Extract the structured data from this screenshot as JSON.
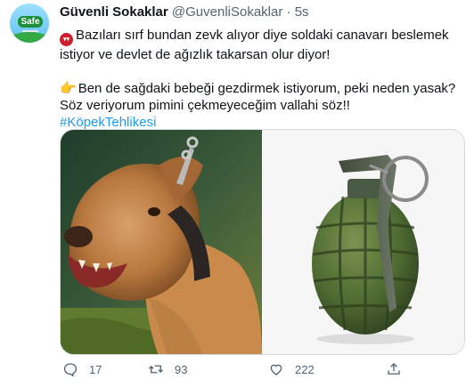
{
  "tweet": {
    "author_name": "Güvenli Sokaklar",
    "author_handle": "@GuvenliSokaklar",
    "separator": "·",
    "time": "5s",
    "avatar_text": "Safe",
    "paragraph1": "Bazıları sırf bundan zevk alıyor diye soldaki canavarı beslemek istiyor ve devlet de ağızlık takarsan olur diyor!",
    "paragraph2": "Ben de sağdaki bebeği gezdirmek istiyorum, peki neden yasak? Söz veriyorum pimini çekmeyeceğim vallahi söz!!",
    "hashtag": "#KöpekTehlikesi",
    "emoji1": "angry-face-emoji",
    "emoji2": "pointing-hand-emoji"
  },
  "media": {
    "left_image": "pit-bull-dog-photo",
    "right_image": "hand-grenade-photo"
  },
  "actions": {
    "reply_count": "17",
    "retweet_count": "93",
    "like_count": "222"
  },
  "colors": {
    "link": "#1d9bf0",
    "secondary_text": "#536471",
    "grenade_green": "#4f6b32"
  }
}
